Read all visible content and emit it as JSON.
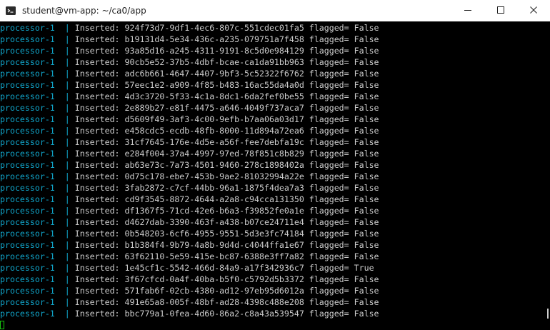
{
  "window": {
    "title": "student@vm-app: ~/ca0/app"
  },
  "terminal": {
    "lines": [
      {
        "service": "processor-1",
        "sep": "|",
        "label": "Inserted:",
        "id": "924f73d7-9df1-4ec6-807c-551cdec01fa5",
        "flag_label": "flagged=",
        "flag": "False"
      },
      {
        "service": "processor-1",
        "sep": "|",
        "label": "Inserted:",
        "id": "b19131d4-5e34-436c-a235-079751a7f458",
        "flag_label": "flagged=",
        "flag": "False"
      },
      {
        "service": "processor-1",
        "sep": "|",
        "label": "Inserted:",
        "id": "93a85d16-a245-4311-9191-8c5d0e984129",
        "flag_label": "flagged=",
        "flag": "False"
      },
      {
        "service": "processor-1",
        "sep": "|",
        "label": "Inserted:",
        "id": "90cb5e52-37b5-4dbf-bcae-ca1da91bb963",
        "flag_label": "flagged=",
        "flag": "False"
      },
      {
        "service": "processor-1",
        "sep": "|",
        "label": "Inserted:",
        "id": "adc6b661-4647-4407-9bf3-5c52322f6762",
        "flag_label": "flagged=",
        "flag": "False"
      },
      {
        "service": "processor-1",
        "sep": "|",
        "label": "Inserted:",
        "id": "57eec1e2-a909-4f85-b483-16ac55da4a0d",
        "flag_label": "flagged=",
        "flag": "False"
      },
      {
        "service": "processor-1",
        "sep": "|",
        "label": "Inserted:",
        "id": "4d3c3720-5f33-4c1a-8dc1-6da2fef0be55",
        "flag_label": "flagged=",
        "flag": "False"
      },
      {
        "service": "processor-1",
        "sep": "|",
        "label": "Inserted:",
        "id": "2e889b27-e81f-4475-a646-4049f737aca7",
        "flag_label": "flagged=",
        "flag": "False"
      },
      {
        "service": "processor-1",
        "sep": "|",
        "label": "Inserted:",
        "id": "d5609f49-3af3-4c00-9efb-b7aa06a03d17",
        "flag_label": "flagged=",
        "flag": "False"
      },
      {
        "service": "processor-1",
        "sep": "|",
        "label": "Inserted:",
        "id": "e458cdc5-ecdb-48fb-8000-11d894a72ea6",
        "flag_label": "flagged=",
        "flag": "False"
      },
      {
        "service": "processor-1",
        "sep": "|",
        "label": "Inserted:",
        "id": "31cf7645-176e-4d5e-a56f-fee7debfa19c",
        "flag_label": "flagged=",
        "flag": "False"
      },
      {
        "service": "processor-1",
        "sep": "|",
        "label": "Inserted:",
        "id": "e284f004-37a4-4997-97ed-78f851c8b829",
        "flag_label": "flagged=",
        "flag": "False"
      },
      {
        "service": "processor-1",
        "sep": "|",
        "label": "Inserted:",
        "id": "ab63e73c-7a73-4501-9460-278c1898402a",
        "flag_label": "flagged=",
        "flag": "False"
      },
      {
        "service": "processor-1",
        "sep": "|",
        "label": "Inserted:",
        "id": "0d75c178-ebe7-453b-9ae2-81032994a22e",
        "flag_label": "flagged=",
        "flag": "False"
      },
      {
        "service": "processor-1",
        "sep": "|",
        "label": "Inserted:",
        "id": "3fab2872-c7cf-44bb-96a1-1875f4dea7a3",
        "flag_label": "flagged=",
        "flag": "False"
      },
      {
        "service": "processor-1",
        "sep": "|",
        "label": "Inserted:",
        "id": "cd9f3545-8872-4644-a2a8-c94cca131350",
        "flag_label": "flagged=",
        "flag": "False"
      },
      {
        "service": "processor-1",
        "sep": "|",
        "label": "Inserted:",
        "id": "df1367f5-71cd-42e6-b6a3-f39852fe0a1e",
        "flag_label": "flagged=",
        "flag": "False"
      },
      {
        "service": "processor-1",
        "sep": "|",
        "label": "Inserted:",
        "id": "d4627dab-3390-463f-a438-b07ce24711e4",
        "flag_label": "flagged=",
        "flag": "False"
      },
      {
        "service": "processor-1",
        "sep": "|",
        "label": "Inserted:",
        "id": "0b548203-6cf6-4955-9551-5d3e3fc74184",
        "flag_label": "flagged=",
        "flag": "False"
      },
      {
        "service": "processor-1",
        "sep": "|",
        "label": "Inserted:",
        "id": "b1b384f4-9b79-4a8b-9d4d-c4044ffa1e67",
        "flag_label": "flagged=",
        "flag": "False"
      },
      {
        "service": "processor-1",
        "sep": "|",
        "label": "Inserted:",
        "id": "63f62110-5e59-415e-bc87-6388e3ff7a82",
        "flag_label": "flagged=",
        "flag": "False"
      },
      {
        "service": "processor-1",
        "sep": "|",
        "label": "Inserted:",
        "id": "1e45cf1c-5542-466d-84a9-a17f342936c7",
        "flag_label": "flagged=",
        "flag": "True"
      },
      {
        "service": "processor-1",
        "sep": "|",
        "label": "Inserted:",
        "id": "3f67cfcd-0a4f-40ba-b5f0-c5792d5b3372",
        "flag_label": "flagged=",
        "flag": "False"
      },
      {
        "service": "processor-1",
        "sep": "|",
        "label": "Inserted:",
        "id": "571fab6f-02cb-4380-ad12-97eb95d6012a",
        "flag_label": "flagged=",
        "flag": "False"
      },
      {
        "service": "processor-1",
        "sep": "|",
        "label": "Inserted:",
        "id": "491e65a8-005f-48bf-ad28-4398c488e208",
        "flag_label": "flagged=",
        "flag": "False"
      },
      {
        "service": "processor-1",
        "sep": "|",
        "label": "Inserted:",
        "id": "bbc779a1-0fea-4d60-86a2-c8a43a539547",
        "flag_label": "flagged=",
        "flag": "False"
      }
    ]
  },
  "colors": {
    "service": "#11a8cd",
    "text": "#cccccc",
    "cursor": "#16c60c",
    "background": "#000000"
  },
  "icons": {
    "app": "terminal-app-icon",
    "minimize": "minimize-icon",
    "maximize": "maximize-icon",
    "close": "close-icon"
  }
}
